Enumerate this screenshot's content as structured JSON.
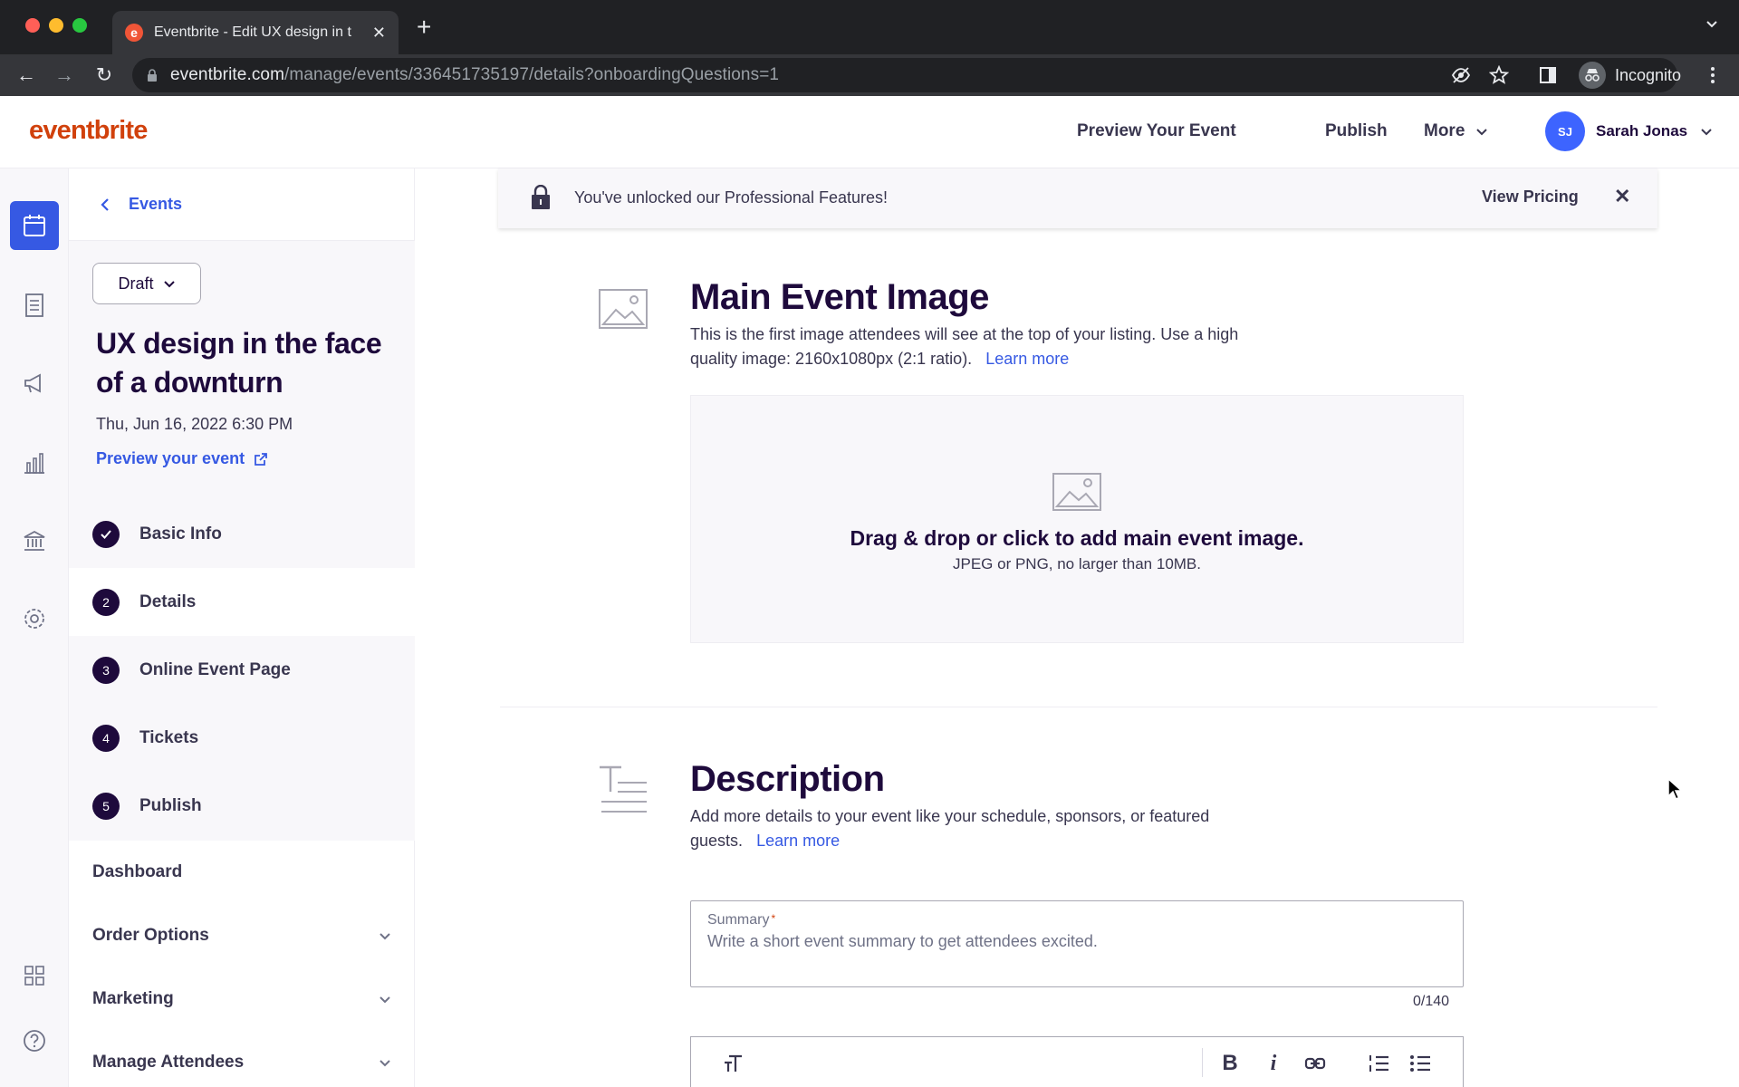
{
  "browser": {
    "tab_title": "Eventbrite - Edit UX design in t",
    "url_domain": "eventbrite.com",
    "url_path": "/manage/events/336451735197/details?onboardingQuestions=1",
    "profile_label": "Incognito"
  },
  "header": {
    "logo": "eventbrite",
    "preview_label": "Preview Your Event",
    "publish_label": "Publish",
    "more_label": "More",
    "user_initials": "SJ",
    "user_name": "Sarah Jonas"
  },
  "left_nav": {
    "back_label": "Events",
    "status": "Draft",
    "event_title": "UX design in the face of a downturn",
    "event_date": "Thu, Jun 16, 2022 6:30 PM",
    "preview_link": "Preview your event",
    "steps": [
      {
        "badge": "",
        "label": "Basic Info",
        "state": "done"
      },
      {
        "badge": "2",
        "label": "Details",
        "state": "active"
      },
      {
        "badge": "3",
        "label": "Online Event Page",
        "state": "pending"
      },
      {
        "badge": "4",
        "label": "Tickets",
        "state": "pending"
      },
      {
        "badge": "5",
        "label": "Publish",
        "state": "pending"
      }
    ],
    "dashboard": "Dashboard",
    "order_options": "Order Options",
    "marketing": "Marketing",
    "manage_attendees": "Manage Attendees"
  },
  "banner": {
    "text": "You've unlocked our Professional Features!",
    "pricing_label": "View Pricing"
  },
  "main_image": {
    "title": "Main Event Image",
    "desc": "This is the first image attendees will see at the top of your listing. Use a high quality image: 2160x1080px (2:1 ratio).",
    "learn_more": "Learn more",
    "drop_title": "Drag & drop or click to add main event image.",
    "drop_sub": "JPEG or PNG, no larger than 10MB."
  },
  "description": {
    "title": "Description",
    "desc": "Add more details to your event like your schedule, sponsors, or featured guests.",
    "learn_more": "Learn more",
    "summary_label": "Summary",
    "summary_required": "*",
    "summary_value": "",
    "summary_placeholder": "Write a short event summary to get attendees excited.",
    "counter": "0/140"
  },
  "colors": {
    "brand": "#d1410c",
    "accent": "#3659e3",
    "ink": "#1e0a3c"
  }
}
